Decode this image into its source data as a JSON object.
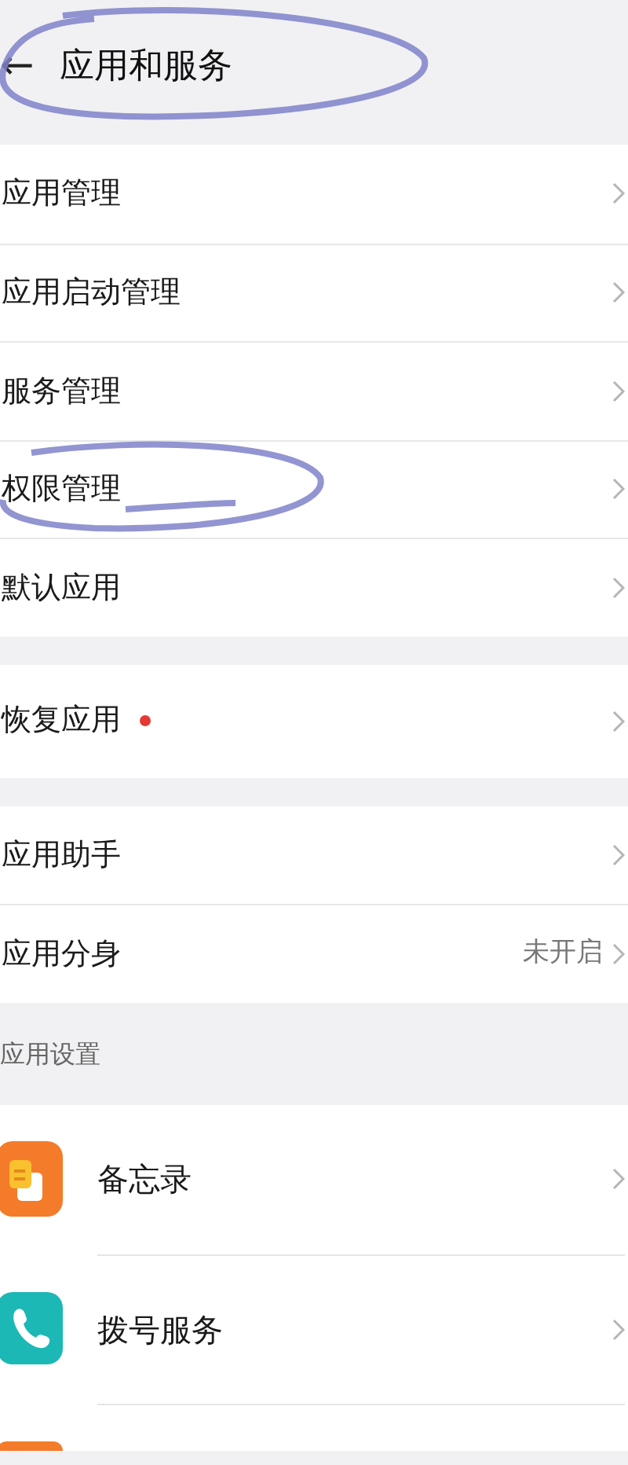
{
  "header": {
    "back_icon": "←",
    "title": "应用和服务"
  },
  "groups": [
    {
      "items": [
        {
          "label": "应用管理",
          "dot": false
        },
        {
          "label": "应用启动管理",
          "dot": false
        },
        {
          "label": "服务管理",
          "dot": false
        },
        {
          "label": "权限管理",
          "dot": false
        },
        {
          "label": "默认应用",
          "dot": false
        }
      ]
    },
    {
      "items": [
        {
          "label": "恢复应用",
          "dot": true
        }
      ]
    },
    {
      "items": [
        {
          "label": "应用助手",
          "dot": false
        },
        {
          "label": "应用分身",
          "value": "未开启",
          "dot": false
        }
      ]
    }
  ],
  "section": {
    "title": "应用设置",
    "items": [
      {
        "label": "备忘录",
        "kind": "notes"
      },
      {
        "label": "拨号服务",
        "kind": "phone"
      },
      {
        "kind": "partial"
      }
    ]
  }
}
